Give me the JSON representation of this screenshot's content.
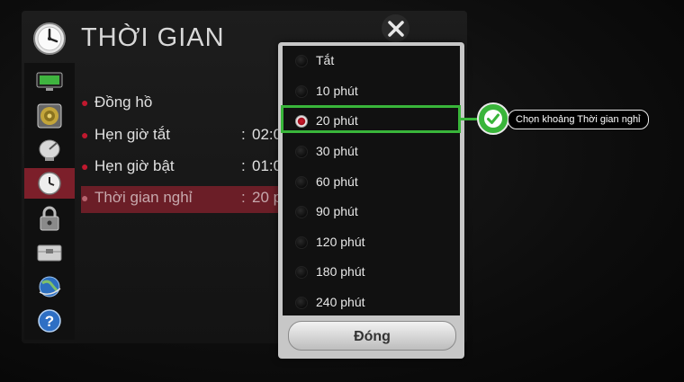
{
  "header": {
    "title": "THỜI GIAN"
  },
  "sidebar": {
    "items": [
      {
        "name": "picture",
        "icon": "monitor-icon"
      },
      {
        "name": "sound",
        "icon": "speaker-icon"
      },
      {
        "name": "channel",
        "icon": "satellite-dish-icon"
      },
      {
        "name": "time",
        "icon": "clock-icon",
        "active": true
      },
      {
        "name": "lock",
        "icon": "padlock-icon"
      },
      {
        "name": "option",
        "icon": "toolbox-icon"
      },
      {
        "name": "network",
        "icon": "globe-icon"
      },
      {
        "name": "support",
        "icon": "help-icon"
      }
    ]
  },
  "menu": {
    "items": [
      {
        "label": "Đồng hồ",
        "colon": "",
        "value": ""
      },
      {
        "label": "Hẹn giờ tắt",
        "colon": ":",
        "value": "02:0"
      },
      {
        "label": "Hẹn giờ bật",
        "colon": ":",
        "value": "01:0"
      },
      {
        "label": "Thời gian nghỉ",
        "colon": ":",
        "value": "20 p"
      }
    ]
  },
  "dropdown": {
    "options": [
      "Tắt",
      "10 phút",
      "20 phút",
      "30 phút",
      "60 phút",
      "90 phút",
      "120 phút",
      "180 phút",
      "240 phút"
    ],
    "selected": "20 phút",
    "close_label": "Đóng"
  },
  "annotation": {
    "callout": "Chọn khoảng Thời gian nghỉ"
  },
  "colors": {
    "accent_red": "#c0182e",
    "highlight_green": "#39b53a"
  }
}
